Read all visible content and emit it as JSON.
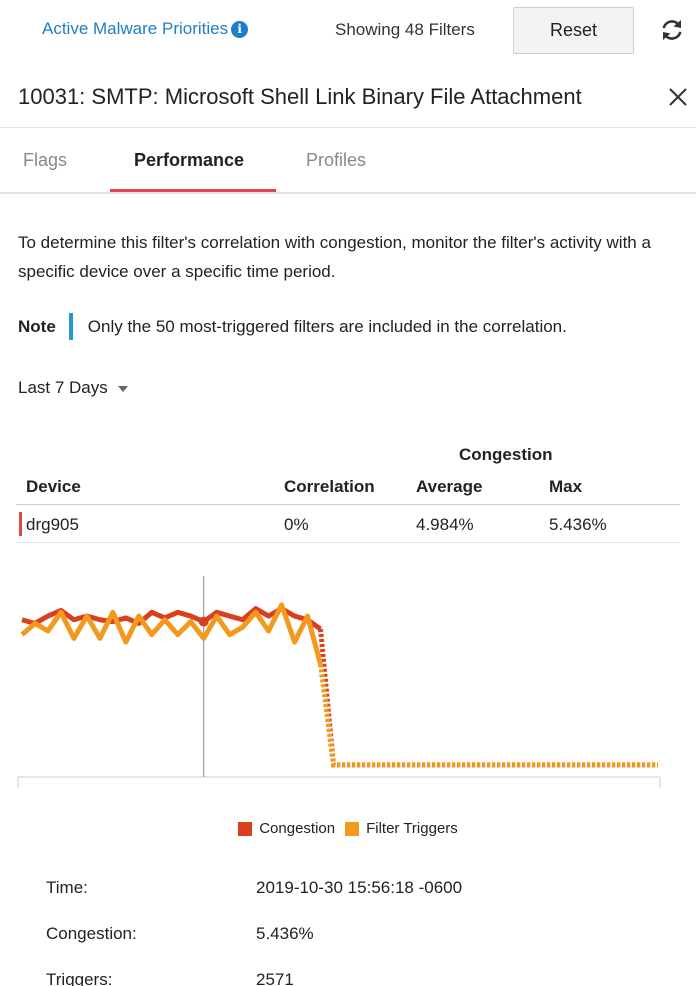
{
  "header": {
    "active_link_label": "Active Malware Priorities",
    "showing_text": "Showing 48 Filters",
    "reset_label": "Reset"
  },
  "panel": {
    "title": "10031: SMTP: Microsoft Shell Link Binary File Attachment",
    "tabs": [
      {
        "label": "Flags",
        "active": false
      },
      {
        "label": "Performance",
        "active": true
      },
      {
        "label": "Profiles",
        "active": false
      }
    ],
    "description": "To determine this filter's correlation with congestion, monitor the filter's activity with a specific device over a specific time period.",
    "note_label": "Note",
    "note_text": "Only the 50 most-triggered filters are included in the correlation.",
    "time_range": "Last 7 Days"
  },
  "table": {
    "group_header": "Congestion",
    "columns": [
      "Device",
      "Correlation",
      "Average",
      "Max"
    ],
    "rows": [
      {
        "device": "drg905",
        "correlation": "0%",
        "average": "4.984%",
        "max": "5.436%"
      }
    ]
  },
  "chart_data": {
    "type": "line",
    "legend_position": "bottom",
    "series": [
      {
        "name": "Congestion",
        "color": "#d9411e",
        "values": [
          0.84,
          0.82,
          0.86,
          0.89,
          0.84,
          0.86,
          0.84,
          0.83,
          0.85,
          0.82,
          0.88,
          0.85,
          0.88,
          0.86,
          0.83,
          0.88,
          0.86,
          0.84,
          0.9,
          0.86,
          0.9,
          0.86,
          0.84,
          0.79,
          0.06,
          0.06,
          0.06,
          0.06,
          0.06,
          0.06,
          0.06,
          0.06,
          0.06,
          0.06,
          0.06,
          0.06,
          0.06,
          0.06,
          0.06,
          0.06,
          0.06,
          0.06,
          0.06,
          0.06,
          0.06,
          0.06,
          0.06,
          0.06,
          0.06,
          0.06
        ]
      },
      {
        "name": "Filter Triggers",
        "color": "#f39a1e",
        "values": [
          0.76,
          0.82,
          0.78,
          0.88,
          0.74,
          0.86,
          0.74,
          0.88,
          0.72,
          0.86,
          0.76,
          0.84,
          0.76,
          0.83,
          0.74,
          0.86,
          0.76,
          0.8,
          0.88,
          0.78,
          0.92,
          0.72,
          0.86,
          0.6,
          0.06,
          0.06,
          0.06,
          0.06,
          0.06,
          0.06,
          0.06,
          0.06,
          0.06,
          0.06,
          0.06,
          0.06,
          0.06,
          0.06,
          0.06,
          0.06,
          0.06,
          0.06,
          0.06,
          0.06,
          0.06,
          0.06,
          0.06,
          0.06,
          0.06,
          0.06
        ]
      }
    ],
    "hover_index": 14,
    "grid": false
  },
  "tooltip": {
    "time_label": "Time:",
    "time_value": "2019-10-30 15:56:18 -0600",
    "congestion_label": "Congestion:",
    "congestion_value": "5.436%",
    "triggers_label": "Triggers:",
    "triggers_value": "2571"
  }
}
